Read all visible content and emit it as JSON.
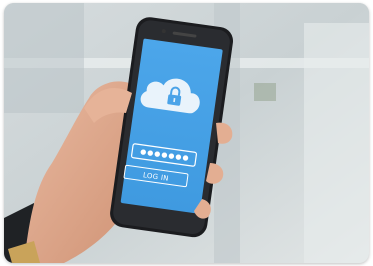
{
  "screen": {
    "password_mask": "●●●●●●●",
    "login_label": "LOG IN",
    "screen_color": "#4aa3e8",
    "icon": "cloud-lock-icon"
  },
  "scene": {
    "background_color": "#cfd6d9",
    "phone_color": "#1b1c1f"
  }
}
